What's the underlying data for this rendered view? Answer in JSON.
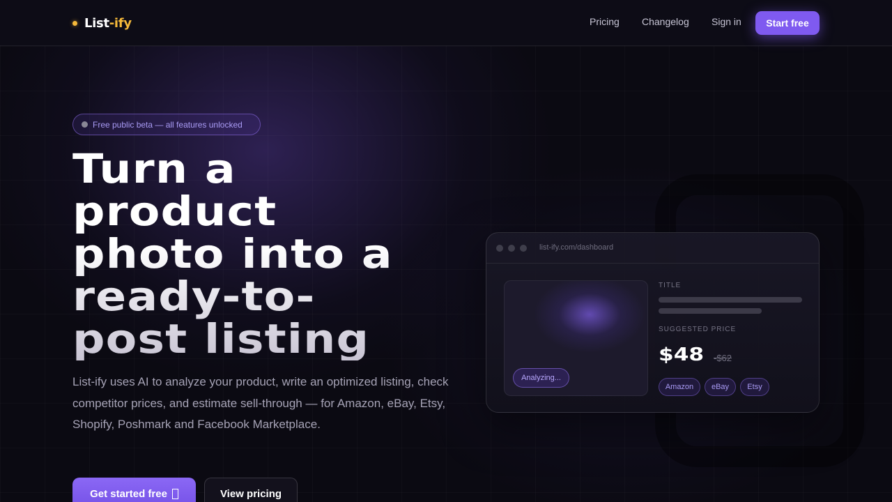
{
  "nav": {
    "logo_main": "List",
    "logo_accent": "-ify",
    "links": [
      "Pricing",
      "Changelog",
      "Sign in"
    ],
    "cta": "Start free"
  },
  "hero": {
    "badge": "Free public beta — all features unlocked",
    "headline_lines": [
      "Turn a",
      "product",
      "photo into a",
      "ready-to-",
      "post listing"
    ],
    "description": "List-ify uses AI to analyze your product, write an optimized listing, check competitor prices, and estimate sell-through — for Amazon, eBay, Etsy, Shopify, Poshmark and Facebook Marketplace.",
    "primary_button": "Get started free",
    "secondary_button": "View pricing"
  },
  "mockup": {
    "url": "list-ify.com/dashboard",
    "status": "Analyzing...",
    "title_label": "TITLE",
    "price_label": "SUGGESTED PRICE",
    "price": "$48",
    "old_price": "-$62",
    "platforms": [
      "Amazon",
      "eBay",
      "Etsy"
    ]
  },
  "colors": {
    "accent": "#7f5af0",
    "logo_accent": "#f5b93a",
    "background": "#0b0a12"
  }
}
